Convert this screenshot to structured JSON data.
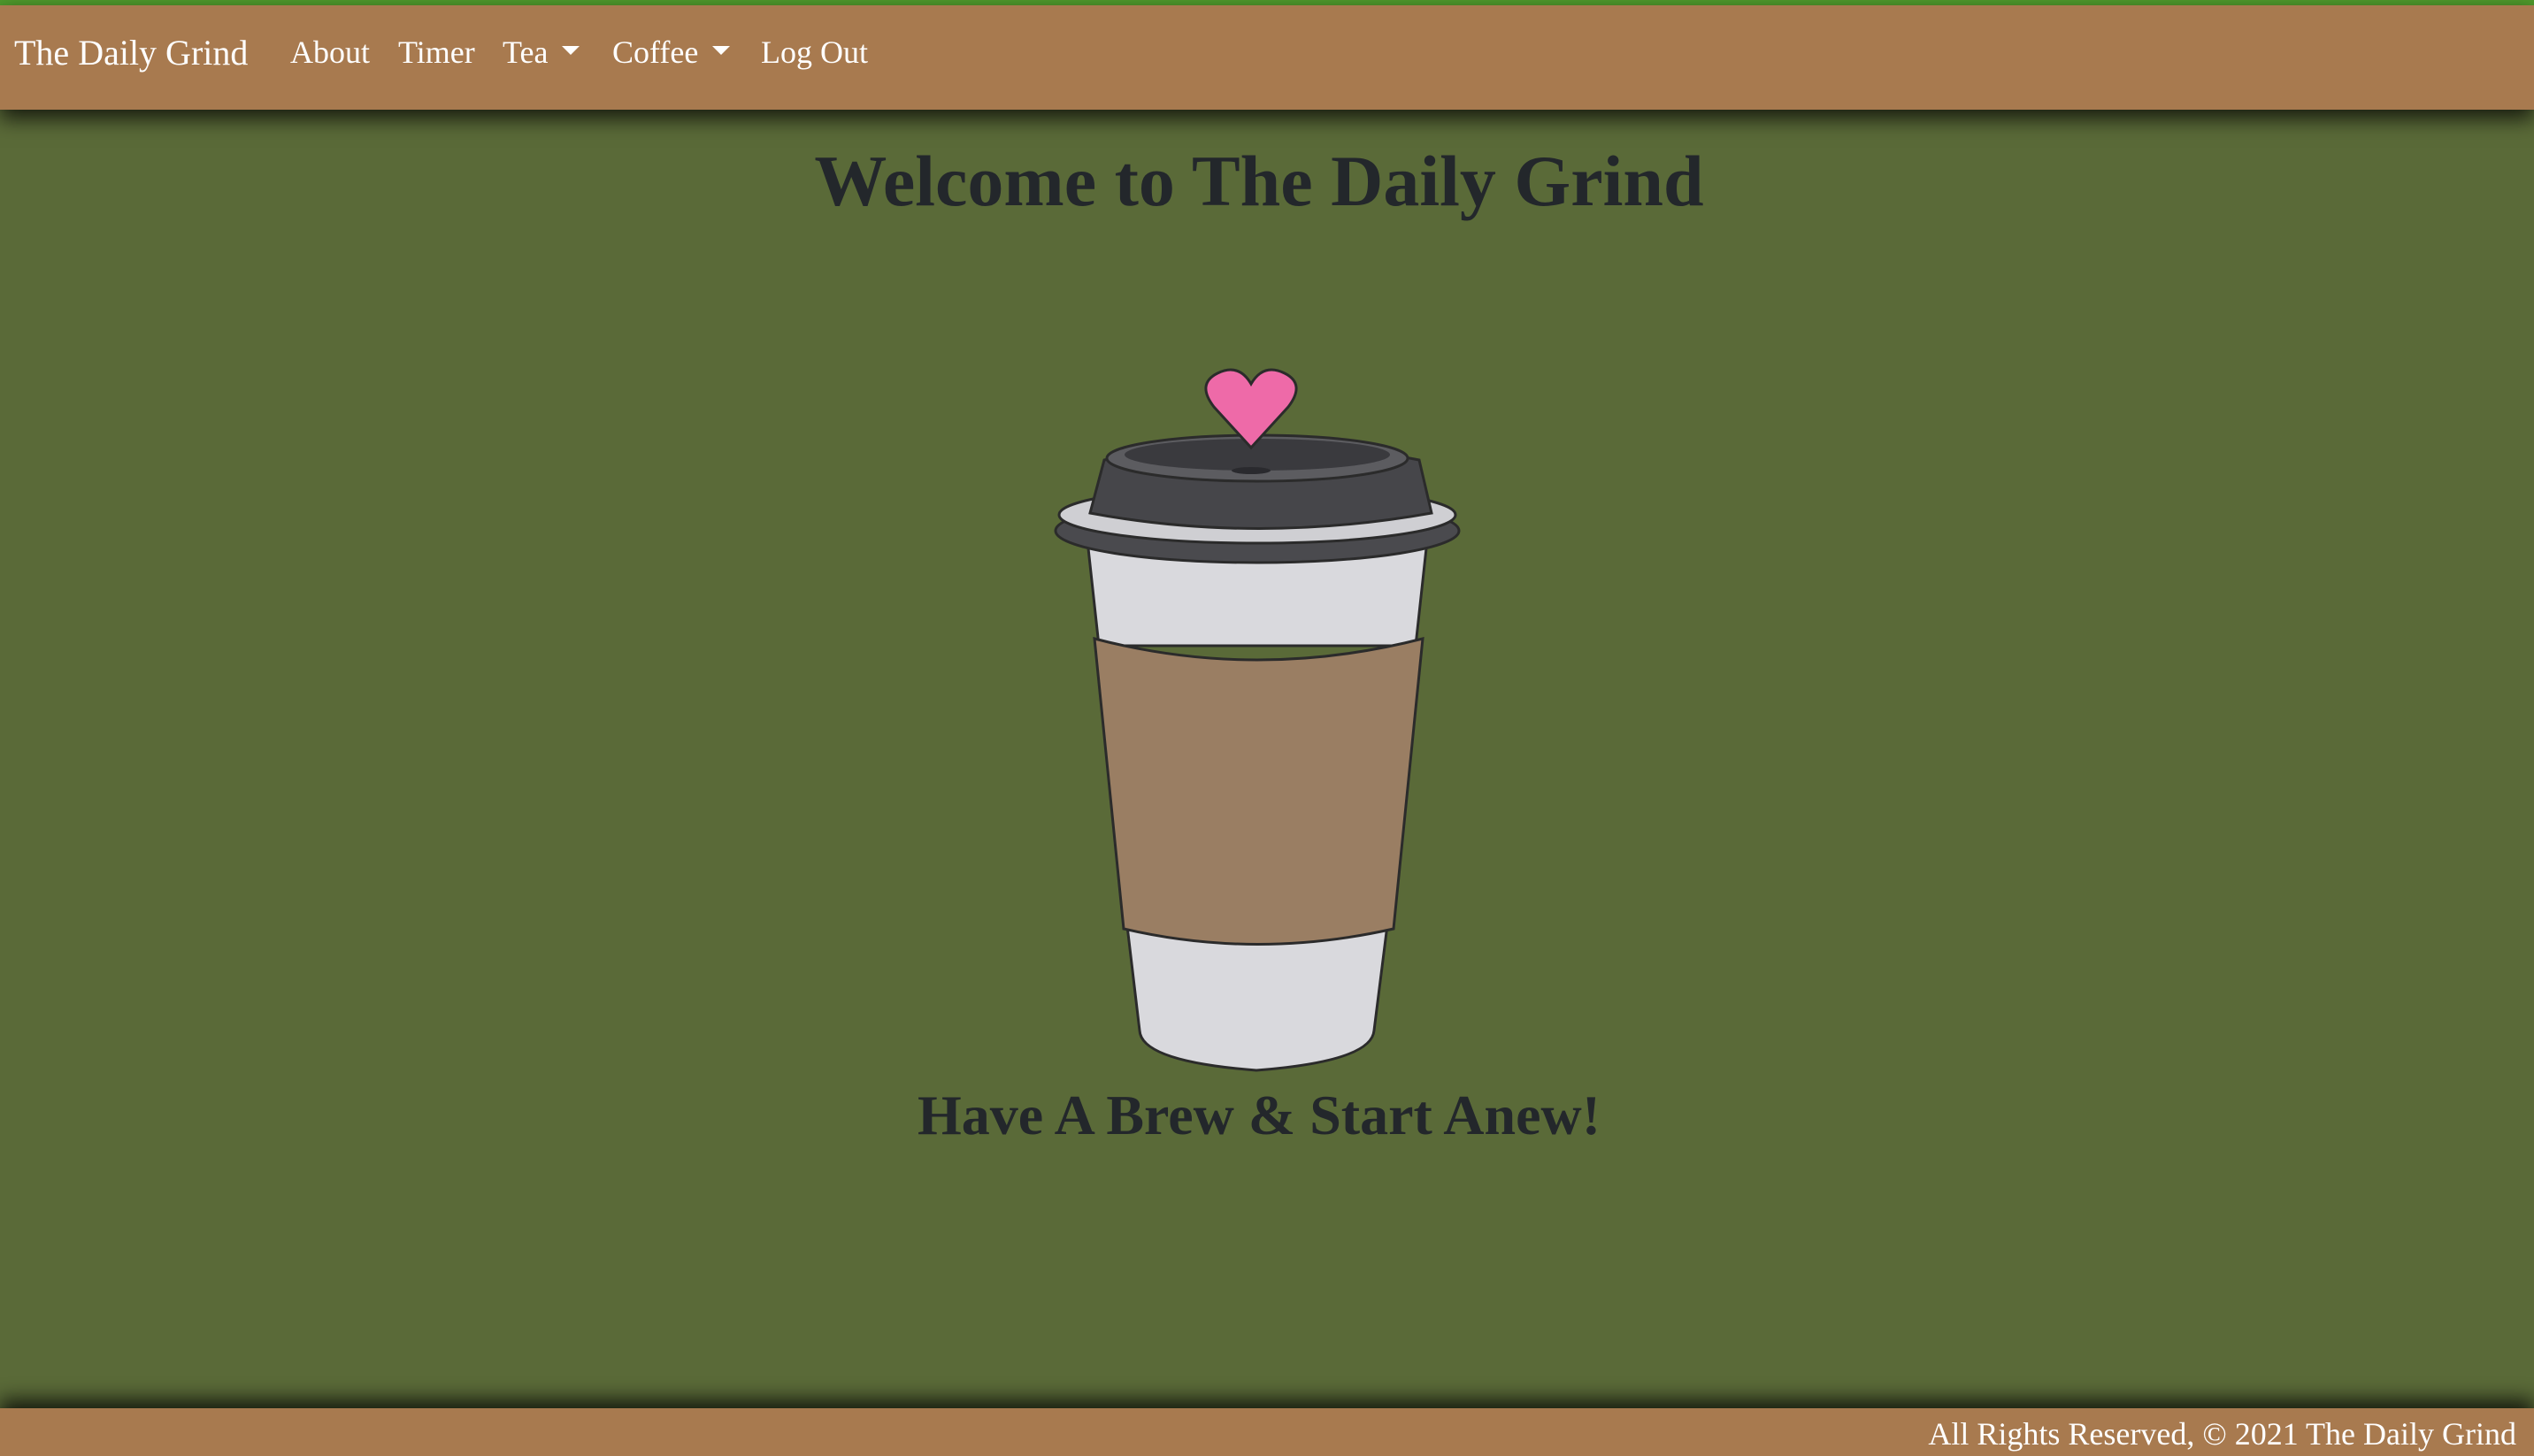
{
  "nav": {
    "brand": "The Daily Grind",
    "items": [
      {
        "label": "About"
      },
      {
        "label": "Timer"
      },
      {
        "label": "Tea"
      },
      {
        "label": "Coffee"
      },
      {
        "label": "Log Out"
      }
    ]
  },
  "main": {
    "heading": "Welcome to The Daily Grind",
    "tagline": "Have A Brew & Start Anew!",
    "illustration": "coffee-cup-with-heart"
  },
  "footer": {
    "text": "All Rights Reserved, © 2021 The Daily Grind"
  },
  "colors": {
    "background": "#5a6a38",
    "navbar": "#a87a4f",
    "accent_line": "#4f9a2c",
    "heading_text": "#23272b",
    "heart": "#ee6aa8",
    "sleeve": "#9a7e63"
  }
}
